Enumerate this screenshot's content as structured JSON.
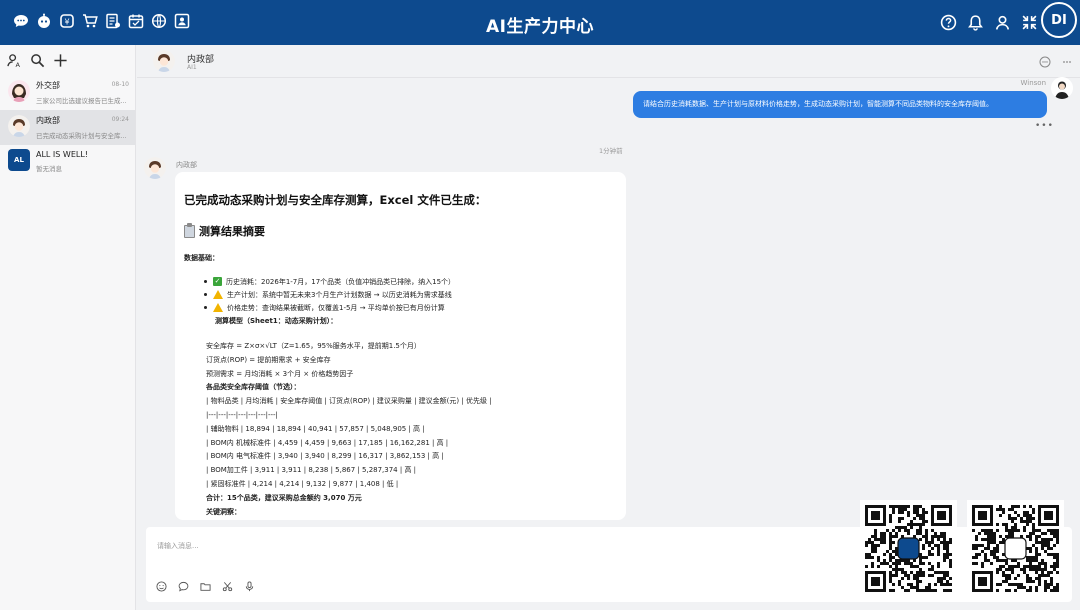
{
  "app": {
    "title": "AI生产力中心",
    "logo_text": "DI"
  },
  "top_icons": [
    "chat-icon",
    "robot-icon",
    "coin-icon",
    "cart-icon",
    "report-icon",
    "calendar-icon",
    "globe-icon",
    "contact-card-icon"
  ],
  "top_right_icons": [
    "help-icon",
    "bell-icon",
    "user-icon",
    "collapse-icon"
  ],
  "sidebar": {
    "conversations": [
      {
        "name": "外交部",
        "time": "08-10",
        "preview": "三家公司比选建议报告已生成...",
        "active": false
      },
      {
        "name": "内政部",
        "time": "09:24",
        "preview": "已完成动态采购计划与安全库...",
        "active": true
      },
      {
        "name": "ALL IS WELL!",
        "avatar_text": "AL",
        "time": "",
        "preview": "暂无消息",
        "active": false
      }
    ]
  },
  "chat": {
    "title": "内政部",
    "subtitle": "AI1",
    "user_name": "Winson",
    "user_message": "请结合历史消耗数据、生产计划与原材料价格走势，生成动态采购计划，智能测算不同品类物料的安全库存阈值。",
    "timestamp": "1分钟前",
    "bot_name": "内政部",
    "bot": {
      "heading": "已完成动态采购计划与安全库存测算，Excel 文件已生成：",
      "summary_title": "测算结果摘要",
      "data_basis_label": "数据基础：",
      "bullets": [
        {
          "icon": "check-icon",
          "text": "历史消耗：2026年1-7月，17个品类（负值冲销品类已排除，纳入15个）"
        },
        {
          "icon": "warning-icon",
          "text": "生产计划：系统中暂无未来3个月生产计划数据 → 以历史消耗为需求基线"
        },
        {
          "icon": "warning-icon",
          "text": "价格走势：查询结果被截断，仅覆盖1-5月 → 平均单价按已有月份计算"
        }
      ],
      "model_title": "测算模型（Sheet1：动态采购计划）：",
      "formulas": [
        "安全库存 = Z×σ×√LT（Z=1.65，95%服务水平，提前期1.5个月）",
        "订货点(ROP) = 提前期需求 + 安全库存",
        "预测需求 = 月均消耗 × 3个月 × 价格趋势因子"
      ],
      "threshold_title": "各品类安全库存阈值（节选）：",
      "table_header": "| 物料品类 | 月均消耗 | 安全库存阈值 | 订货点(ROP) | 建议采购量 | 建议金额(元) | 优先级 |",
      "table_sep": "|---|---|---|---|---|---|---|",
      "table_rows": [
        "| 辅助物料 | 18,894 | 18,894 | 40,941 | 57,857 | 5,048,905 | 高 |",
        "| BOM内 机械标准件 | 4,459 | 4,459 | 9,663 | 17,185 | 16,162,281 | 高 |",
        "| BOM内 电气标准件 | 3,940 | 3,940 | 8,299 | 16,317 | 3,862,153 | 高 |",
        "| BOM加工件 | 3,911 | 3,911 | 8,238 | 5,867 | 5,287,374 | 高 |",
        "| 紧固标准件 | 4,214 | 4,214 | 9,132 | 9,877 | 1,408 | 低 |"
      ],
      "total_line": "合计：15个品类，建议采购总金额约 3,070 万元",
      "insight_title": "关键洞察："
    }
  },
  "input": {
    "placeholder": "请输入消息..."
  },
  "input_tools": [
    "emoji-icon",
    "comment-icon",
    "folder-icon",
    "scissors-icon",
    "microphone-icon"
  ]
}
